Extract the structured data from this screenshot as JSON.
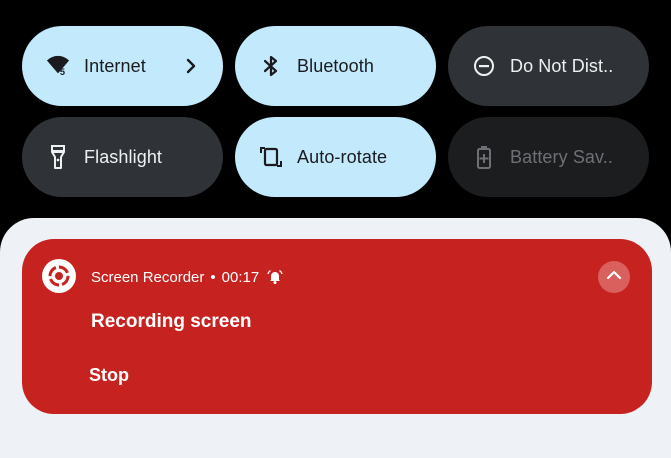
{
  "tiles": [
    {
      "label": "Internet",
      "state": "on",
      "icon": "wifi-signal-5-icon",
      "chevron": "chevron-right-icon"
    },
    {
      "label": "Bluetooth",
      "state": "on",
      "icon": "bluetooth-icon"
    },
    {
      "label": "Do Not Dist..",
      "state": "off",
      "icon": "do-not-disturb-icon"
    },
    {
      "label": "Flashlight",
      "state": "off",
      "icon": "flashlight-icon"
    },
    {
      "label": "Auto-rotate",
      "state": "on",
      "icon": "auto-rotate-icon"
    },
    {
      "label": "Battery Sav..",
      "state": "unavailable",
      "icon": "battery-saver-icon"
    }
  ],
  "wifi_badge": "5",
  "notification": {
    "app_name": "Screen Recorder",
    "separator": "•",
    "elapsed": "00:17",
    "title": "Recording screen",
    "action_label": "Stop",
    "background_color": "#c62320",
    "icons": [
      "screen-record-icon",
      "alarm-bell-icon",
      "chevron-up-icon"
    ]
  },
  "colors": {
    "tile_on": "#c2e9fc",
    "tile_off": "#2f3337",
    "tile_unavailable": "#1b1d1f",
    "shade": "#eef1f5"
  }
}
